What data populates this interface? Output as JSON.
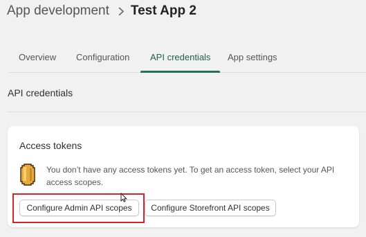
{
  "header": {
    "breadcrumb": "App development",
    "title": "Test App 2"
  },
  "tabs": [
    {
      "label": "Overview",
      "active": false
    },
    {
      "label": "Configuration",
      "active": false
    },
    {
      "label": "API credentials",
      "active": true
    },
    {
      "label": "App settings",
      "active": false
    }
  ],
  "section": {
    "title": "API credentials"
  },
  "access_tokens": {
    "title": "Access tokens",
    "message": "You don’t have any access tokens yet. To get an access token, select your API access scopes.",
    "admin_button_label": "Configure Admin API scopes",
    "storefront_button_label": "Configure Storefront API scopes"
  },
  "colors": {
    "accent": "#1f6f5f",
    "highlight": "#d42424",
    "background": "#f1f1f1"
  },
  "icons": {
    "breadcrumb_separator": "chevron-right-icon",
    "token": "token-icon"
  }
}
